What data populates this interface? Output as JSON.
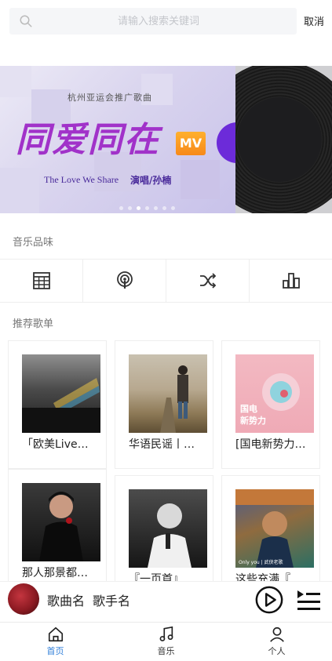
{
  "search": {
    "placeholder": "请输入搜索关键词",
    "value": "",
    "cancel_label": "取消"
  },
  "banner": {
    "subtitle": "杭州亚运会推广歌曲",
    "title": "同爱同在",
    "badge": "MV",
    "english_title": "The Love We Share",
    "singer_label": "演唱/孙楠",
    "page_count": 7,
    "active_page": 3
  },
  "sections": {
    "music_taste": "音乐品味",
    "recommended": "推荐歌单"
  },
  "quick_icons": [
    "calendar-grid-icon",
    "podcast-icon",
    "shuffle-icon",
    "chart-bars-icon"
  ],
  "playlists": [
    {
      "title": "「欧美Live…",
      "cover": "concert-crowd-cover"
    },
    {
      "title": "华语民谣丨…",
      "cover": "guitar-road-cover"
    },
    {
      "title": "[国电新势力…",
      "cover": "pink-record-cover",
      "cover_text": "国电\n新势力"
    },
    {
      "title": "那人那景都…",
      "cover": "man-rose-cover"
    },
    {
      "title": "『一页首』",
      "cover": "man-mic-cover"
    },
    {
      "title": "这些充满『…",
      "cover": "colorful-portrait-cover",
      "cover_text": "Only you | 武侠老歌"
    }
  ],
  "player": {
    "song": "歌曲名",
    "singer": "歌手名"
  },
  "tabs": [
    {
      "label": "首页",
      "icon": "home-icon",
      "active": true
    },
    {
      "label": "音乐",
      "icon": "music-note-icon",
      "active": false
    },
    {
      "label": "个人",
      "icon": "person-icon",
      "active": false
    }
  ],
  "colors": {
    "accent": "#2f7ed8",
    "banner_title": "#a132c9",
    "badge": "#f7891a"
  }
}
